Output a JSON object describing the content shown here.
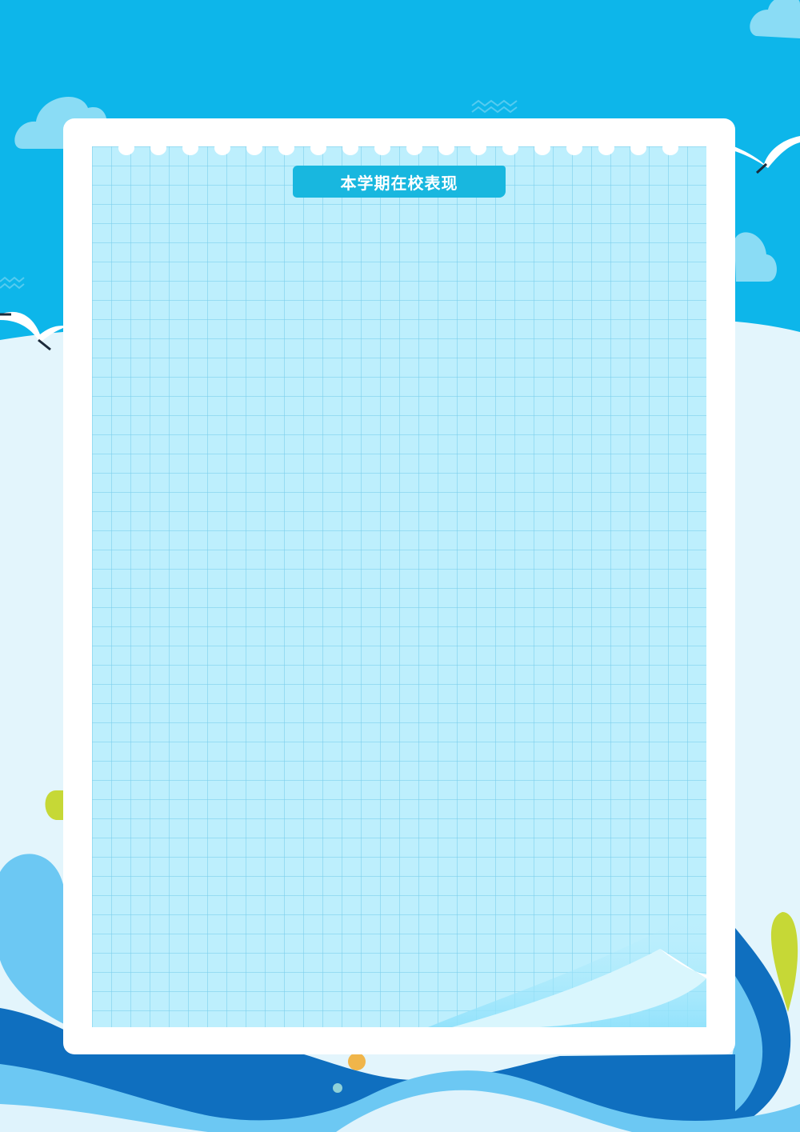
{
  "page": {
    "title": "本学期在校表现"
  },
  "colors": {
    "sky": "#0db6ea",
    "hill": "#e3f5fc",
    "frame": "#ffffff",
    "sheet": "#bdeffd",
    "title_tag": "#18b7df",
    "wave_dark": "#0f6fbf",
    "wave_light": "#6cc8f3",
    "accent_yellow": "#c6d836",
    "accent_orange": "#f0b54a"
  },
  "icons": [
    "cloud-icon",
    "seagull-icon",
    "zigzag-icon",
    "wave-icon",
    "leaf-icon",
    "dot-icon"
  ]
}
